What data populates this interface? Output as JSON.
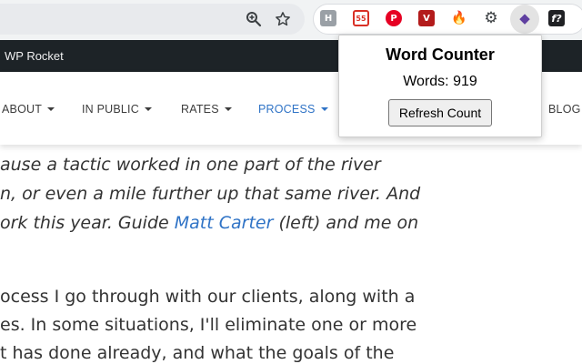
{
  "browser": {
    "zoom_icon": "zoom-in-icon",
    "bookmark_icon": "star-icon",
    "extensions": [
      {
        "name": "hemingway",
        "glyph": "H",
        "color": "#9aa0a6"
      },
      {
        "name": "ad-blocker",
        "glyph": "55",
        "color": "#d93025"
      },
      {
        "name": "pinterest",
        "glyph": "P",
        "color": "#e60023"
      },
      {
        "name": "vivaldi-v",
        "glyph": "V",
        "color": "#b31b1b"
      },
      {
        "name": "fire",
        "glyph": "🔥",
        "color": "#ff6d00"
      },
      {
        "name": "settings-gear",
        "glyph": "⚙",
        "color": "#3c4043"
      },
      {
        "name": "word-counter",
        "glyph": "◆",
        "color": "#5f6368"
      },
      {
        "name": "formula-f",
        "glyph": "f?",
        "color": "#202124"
      }
    ]
  },
  "admin_bar": {
    "label": "WP Rocket"
  },
  "nav": {
    "items": [
      {
        "label": "ABOUT",
        "dropdown": true,
        "active": false
      },
      {
        "label": "IN PUBLIC",
        "dropdown": true,
        "active": false
      },
      {
        "label": "RATES",
        "dropdown": true,
        "active": false
      },
      {
        "label": "PROCESS",
        "dropdown": true,
        "active": true
      },
      {
        "label": "BLOG",
        "dropdown": false,
        "active": false
      }
    ]
  },
  "article": {
    "lines": [
      {
        "text": "ause a tactic worked in one part of the river",
        "italic": true
      },
      {
        "text": "n, or even a mile further up that same river. And",
        "italic": true
      },
      {
        "before": "ork this year. Guide ",
        "link": "Matt Carter",
        "after": " (left) and me on",
        "italic": true
      },
      {
        "text": "ocess I go through with our clients, along with a",
        "italic": false
      },
      {
        "text": "es. In some situations, I'll eliminate one or more",
        "italic": false
      },
      {
        "text": "t has done already, and what the goals of the",
        "italic": false
      }
    ]
  },
  "popup": {
    "title": "Word Counter",
    "count_text": "Words: 919",
    "button_label": "Refresh Count"
  }
}
